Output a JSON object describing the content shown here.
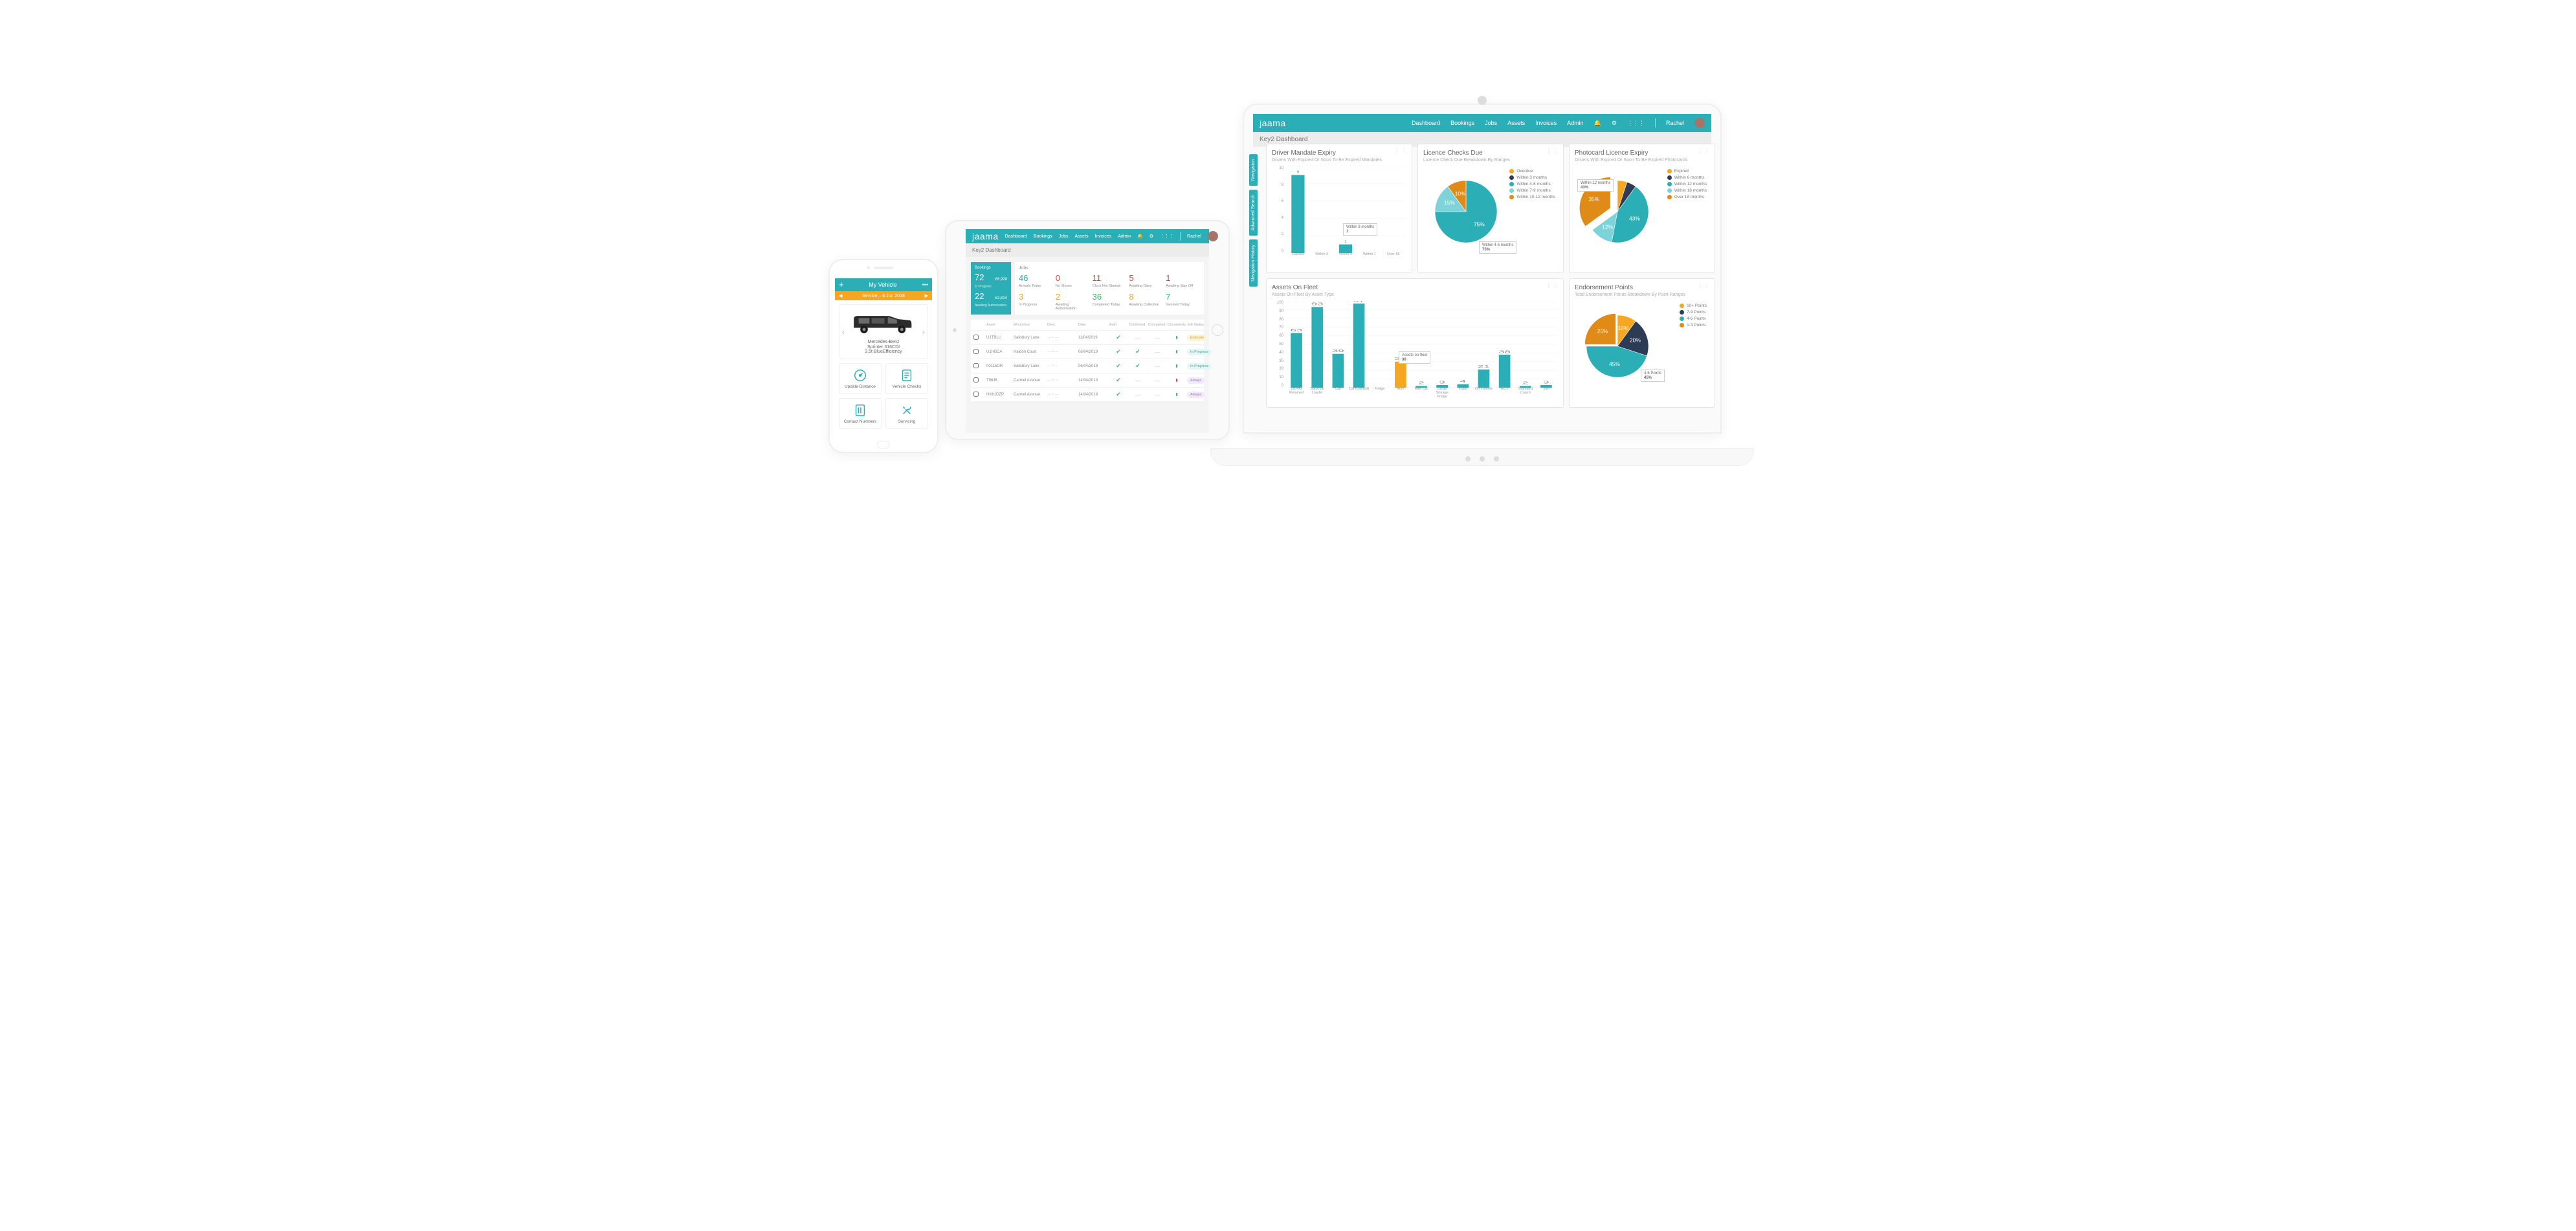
{
  "brand": "jaama",
  "nav": {
    "dashboard": "Dashboard",
    "bookings": "Bookings",
    "jobs": "Jobs",
    "assets": "Assets",
    "invoices": "Invoices",
    "admin": "Admin",
    "user": "Rachel"
  },
  "subheader": "Key2 Dashboard",
  "sidetabs": {
    "nav": "Navigation",
    "search": "Advanced Search",
    "history": "Navigation History"
  },
  "colors": {
    "teal": "#2baeb5",
    "orange": "#f5a623",
    "navy": "#2d3b56",
    "lteal": "#7dd3d8",
    "dorange": "#e08a18"
  },
  "cards": {
    "mandate": {
      "title": "Driver Mandate Expiry",
      "sub": "Drivers With Expired Or Soon To Be Expired Mandates",
      "callout": "Within 9 months",
      "calloutVal": "1"
    },
    "licence": {
      "title": "Licence Checks Due",
      "sub": "Licence Check Due Breakdown By Ranges",
      "legend": [
        "Overdue",
        "Within 3 months",
        "Within 4-6 months",
        "Within 7-9 months",
        "Within 10-12 months"
      ],
      "call1": "Within 4-6 months",
      "call1v": "75%"
    },
    "photo": {
      "title": "Photocard Licence Expiry",
      "sub": "Drivers With Expired Or Soon To Be Expired Photocards",
      "legend": [
        "Expired",
        "Within 6 months",
        "Within 12 months",
        "Within 18 months",
        "Over 18 months"
      ],
      "call1": "Within 12 months",
      "call1v": "43%"
    },
    "fleet": {
      "title": "Assets On Fleet",
      "sub": "Assets On Fleet By Asset Type",
      "callout": "Assets on fleet",
      "calloutVal": "30"
    },
    "endorse": {
      "title": "Endorsement Points",
      "sub": "Total Endorsement Points Breakdown By Point Ranges",
      "legend": [
        "10+ Points",
        "7-9 Points",
        "4-6 Points",
        "1-3 Points"
      ],
      "call1": "4-6 Points",
      "call1v": "45%"
    }
  },
  "chart_data": [
    {
      "id": "mandate",
      "type": "bar",
      "categories": [
        "Expired",
        "Within 3",
        "Within 9",
        "Within 1",
        "Over 18"
      ],
      "values": [
        9,
        0,
        1,
        0,
        0
      ],
      "ylim": [
        0,
        10
      ],
      "yticks": [
        0,
        2,
        4,
        6,
        8,
        10
      ]
    },
    {
      "id": "licence",
      "type": "pie",
      "series": [
        {
          "name": "Overdue",
          "value": 0,
          "color": "#f5a623"
        },
        {
          "name": "Within 3 months",
          "value": 0,
          "color": "#2d3b56"
        },
        {
          "name": "Within 4-6 months",
          "value": 75,
          "color": "#2baeb5"
        },
        {
          "name": "Within 7-9 months",
          "value": 15,
          "color": "#7dd3d8"
        },
        {
          "name": "Within 10-12 months",
          "value": 10,
          "color": "#e08a18"
        }
      ]
    },
    {
      "id": "photo",
      "type": "pie",
      "series": [
        {
          "name": "Expired",
          "value": 5,
          "color": "#f5a623"
        },
        {
          "name": "Within 6 months",
          "value": 5,
          "color": "#2d3b56"
        },
        {
          "name": "Within 12 months",
          "value": 43,
          "color": "#2baeb5"
        },
        {
          "name": "Within 18 months",
          "value": 12,
          "color": "#7dd3d8"
        },
        {
          "name": "Over 18 months",
          "value": 35,
          "color": "#e08a18",
          "inner": 10
        }
      ]
    },
    {
      "id": "fleet",
      "type": "bar",
      "categories": [
        "1st 4x2 Retained",
        "Backhoe Loader",
        "Car",
        "Car (Owned)",
        "Fridge",
        "HGV",
        "Hire Car",
        "Large Storage Fridge",
        "Plant",
        "On Wheels",
        "RCV",
        "Standard Coach",
        "Van"
      ],
      "values": [
        63,
        93,
        39,
        97,
        0,
        30,
        2,
        3,
        4,
        21,
        38,
        2,
        3
      ],
      "ylim": [
        0,
        100
      ],
      "yticks": [
        0,
        10,
        20,
        30,
        40,
        50,
        60,
        70,
        80,
        90,
        100
      ]
    },
    {
      "id": "endorse",
      "type": "pie",
      "series": [
        {
          "name": "10+ Points",
          "value": 10,
          "color": "#f5a623"
        },
        {
          "name": "7-9 Points",
          "value": 20,
          "color": "#2d3b56"
        },
        {
          "name": "4-6 Points",
          "value": 45,
          "color": "#2baeb5"
        },
        {
          "name": "1-3 Points",
          "value": 25,
          "color": "#e08a18",
          "inner": 3
        }
      ]
    }
  ],
  "tablet": {
    "stats": {
      "bookingsTitle": "Bookings",
      "bookings1": "72",
      "bookings1v": "£6,928",
      "bookings1l": "In Progress",
      "bookings2": "22",
      "bookings2v": "£3,814",
      "bookings2l": "Awaiting Authorisation",
      "jobsTitle": "Jobs",
      "cells": [
        {
          "v": "46",
          "l": "Arrivals Today",
          "c": "#2baeb5"
        },
        {
          "v": "0",
          "l": "No Shows",
          "c": "#d24444"
        },
        {
          "v": "11",
          "l": "Clock Not Started",
          "c": "#d24444"
        },
        {
          "v": "5",
          "l": "Awaiting Diary",
          "c": "#d24444"
        },
        {
          "v": "1",
          "l": "Awaiting Sign Off",
          "c": "#d24444"
        },
        {
          "v": "3",
          "l": "In Progress",
          "c": "#f5a623"
        },
        {
          "v": "2",
          "l": "Awaiting Authorisation",
          "c": "#f5a623"
        },
        {
          "v": "36",
          "l": "Completed Today",
          "c": "#42b36b"
        },
        {
          "v": "8",
          "l": "Awaiting Collection",
          "c": "#f5a623"
        },
        {
          "v": "7",
          "l": "Invoiced Today",
          "c": "#42b36b"
        }
      ]
    },
    "table": {
      "headers": [
        "",
        "Asset",
        "Workshop",
        "Desc",
        "Date",
        "Auth",
        "Confirmed",
        "Completed",
        "Documents",
        "Job Status"
      ],
      "rows": [
        {
          "asset": "U1TBLU",
          "ws": "Salisbury Lane",
          "desc": "— • —",
          "date": "11/04/2019",
          "auth": true,
          "conf": false,
          "comp": false,
          "docs": "g",
          "status": "Estimate"
        },
        {
          "asset": "U1HBCA",
          "ws": "Haldon Court",
          "desc": "— • —",
          "date": "06/04/2019",
          "auth": true,
          "conf": true,
          "comp": false,
          "docs": "g",
          "status": "In Progress"
        },
        {
          "asset": "00115GR",
          "ws": "Salisbury Lane",
          "desc": "— • —",
          "date": "06/04/2019",
          "auth": true,
          "conf": true,
          "comp": false,
          "docs": "g",
          "status": "In Progress"
        },
        {
          "asset": "T96J6",
          "ws": "Carmel Avenue",
          "desc": "— • —",
          "date": "14/04/2019",
          "auth": true,
          "conf": false,
          "comp": false,
          "docs": "r",
          "status": "Always"
        },
        {
          "asset": "HX61DZP",
          "ws": "Carmel Avenue",
          "desc": "— • —",
          "date": "14/04/2019",
          "auth": true,
          "conf": false,
          "comp": false,
          "docs": "g",
          "status": "Always"
        }
      ]
    }
  },
  "phone": {
    "title": "My Vehicle",
    "banner": "Service – 6 Jun 2018",
    "vehicle": {
      "line1": "Mercedes-Benz",
      "line2": "Sprinter 316CDI",
      "line3": "3.5t BlueEfficiency"
    },
    "tiles": {
      "t1": "Update Distance",
      "t2": "Vehicle Checks",
      "t3": "Contact Numbers",
      "t4": "Servicing"
    }
  }
}
